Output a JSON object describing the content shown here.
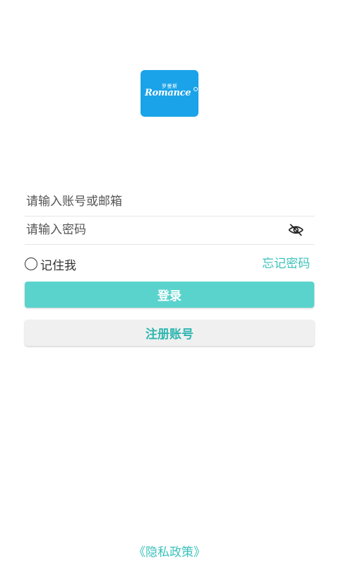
{
  "logo": {
    "cn_text": "罗曼斯",
    "en_text": "Romance",
    "color": "#1aa3e8"
  },
  "login_form": {
    "account_placeholder": "请输入账号或邮箱",
    "password_placeholder": "请输入密码",
    "password_toggle_icon": "eye-off-icon"
  },
  "options": {
    "remember_label": "记住我",
    "forgot_label": "忘记密码"
  },
  "buttons": {
    "login_label": "登录",
    "register_label": "注册账号"
  },
  "footer": {
    "privacy_label": "《隐私政策》"
  },
  "colors": {
    "accent": "#5bd3cd",
    "accent_text": "#3cc2bb"
  }
}
